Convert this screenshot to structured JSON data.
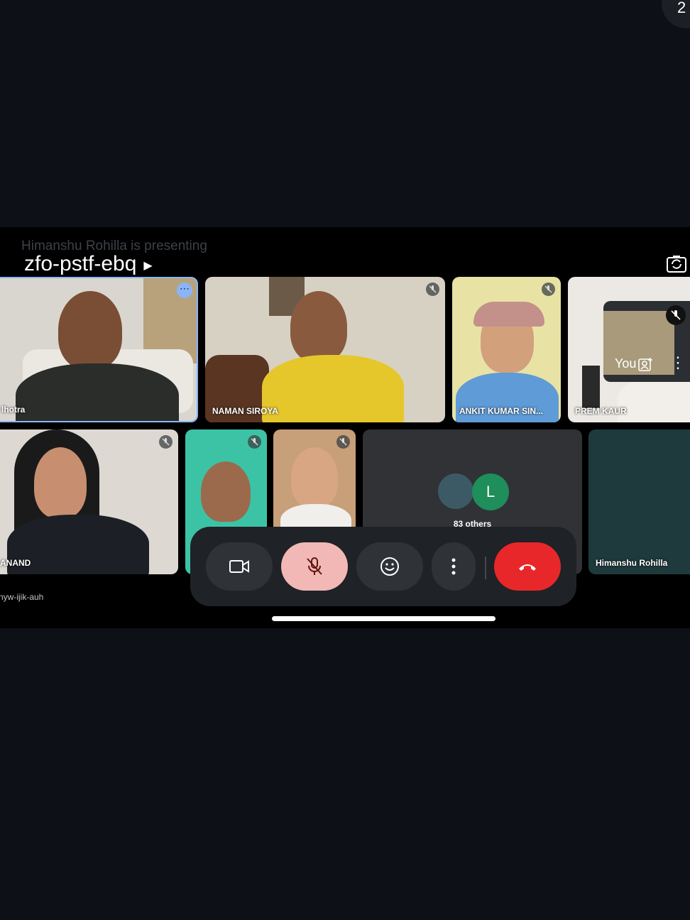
{
  "status_badge": "2",
  "header": {
    "presenting_text": "Himanshu Rohilla is presenting",
    "meeting_code": "zfo-pstf-ebq"
  },
  "participants": [
    {
      "name": "lhotra"
    },
    {
      "name": "NAMAN SIROYA"
    },
    {
      "name": "ANKIT KUMAR SIN..."
    },
    {
      "name": "PREM KAUR"
    },
    {
      "name": "ANAND"
    },
    {
      "name": "Himanshu Rohilla"
    }
  ],
  "others": {
    "avatar_letter": "L",
    "label": "83 others"
  },
  "self_view": {
    "label": "You"
  },
  "bottom_code": "nyw-ijik-auh",
  "colors": {
    "mute_active": "#f2b8b5",
    "end_call": "#e8272a",
    "control_bg": "#2f3237",
    "avatar_green": "#1e8e5a"
  },
  "icons": {
    "camera": "video-camera-icon",
    "mic": "mic-off-icon",
    "emoji": "emoji-icon",
    "more": "more-vert-icon",
    "end": "call-end-icon"
  }
}
